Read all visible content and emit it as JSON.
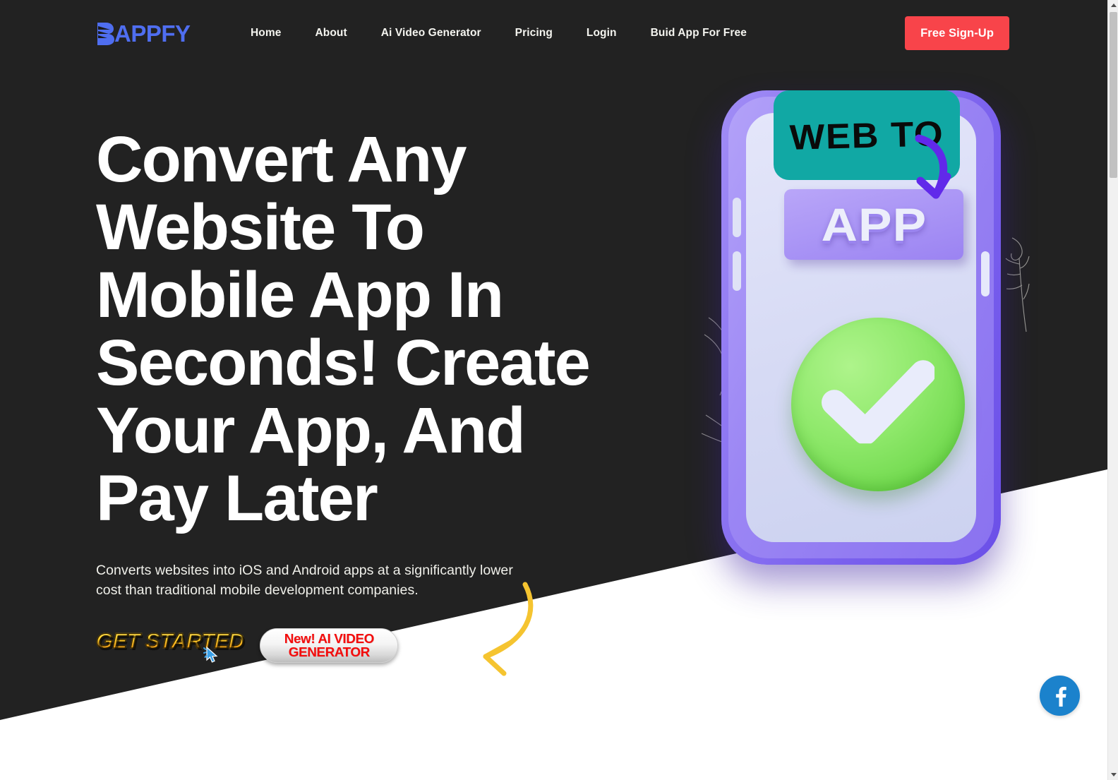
{
  "nav": {
    "logo_text": "APPFY",
    "logo_icon": "wing-mark-icon",
    "links": [
      {
        "label": "Home"
      },
      {
        "label": "About"
      },
      {
        "label": "Ai Video Generator"
      },
      {
        "label": "Pricing"
      },
      {
        "label": "Login"
      },
      {
        "label": "Buid App For Free"
      }
    ],
    "signup_label": "Free Sign-Up"
  },
  "hero": {
    "title": "Convert Any Website To Mobile App In Seconds! Create Your App, And Pay Later",
    "subtitle": "Converts websites into iOS and Android apps at a significantly lower cost than traditional mobile development companies.",
    "cta_primary": "GET STARTED",
    "cta_secondary_line1": "New! AI VIDEO",
    "cta_secondary_line2": "GENERATOR"
  },
  "illustration": {
    "bubble_text": "WEB TO",
    "plaque_text": "APP",
    "arrow_icon": "curved-arrow-icon",
    "check_icon": "check-circle-icon",
    "phone_icon": "smartphone-icon"
  },
  "floating": {
    "facebook_label": "f",
    "facebook_icon": "facebook-icon"
  },
  "colors": {
    "background_dark": "#222222",
    "background_light": "#ffffff",
    "accent_red": "#f8444a",
    "accent_blue": "#4f6ef0",
    "bubble_teal": "#11a8a4",
    "phone_purple": "#7c63ee",
    "check_green": "#8ee86a",
    "arrow_yellow": "#f5c430",
    "facebook_blue": "#1b82cc",
    "cta_gold": "#ffd02e",
    "cta_red_text": "#f40d0d"
  }
}
